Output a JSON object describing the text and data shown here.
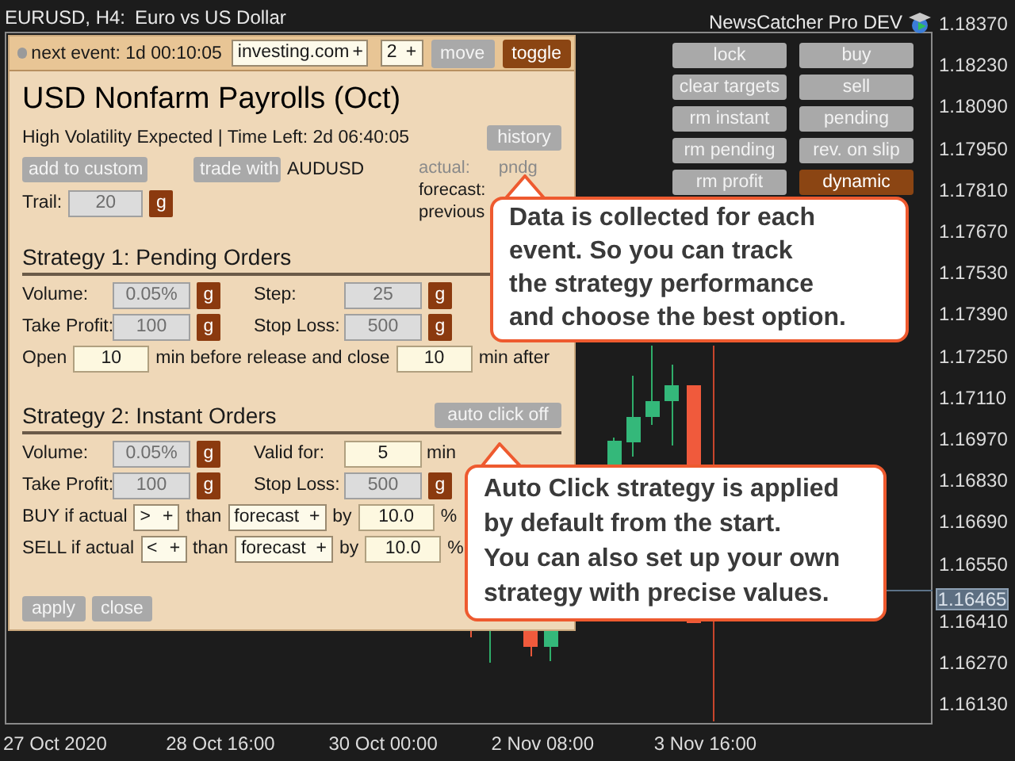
{
  "chart_header": {
    "symbol": "EURUSD, H4:",
    "description": "Euro vs US Dollar"
  },
  "expert_label": "NewsCatcher Pro DEV",
  "control_buttons": [
    {
      "label": "lock",
      "active": false
    },
    {
      "label": "buy",
      "active": false
    },
    {
      "label": "clear targets",
      "active": false
    },
    {
      "label": "sell",
      "active": false
    },
    {
      "label": "rm instant",
      "active": false
    },
    {
      "label": "pending",
      "active": false
    },
    {
      "label": "rm pending",
      "active": false
    },
    {
      "label": "rev. on slip",
      "active": false
    },
    {
      "label": "rm profit",
      "active": false
    },
    {
      "label": "dynamic",
      "active": true
    }
  ],
  "price_axis": [
    {
      "label": "1.18370",
      "current": false
    },
    {
      "label": "1.18230",
      "current": false
    },
    {
      "label": "1.18090",
      "current": false
    },
    {
      "label": "1.17950",
      "current": false
    },
    {
      "label": "1.17810",
      "current": false
    },
    {
      "label": "1.17670",
      "current": false
    },
    {
      "label": "1.17530",
      "current": false
    },
    {
      "label": "1.17390",
      "current": false
    },
    {
      "label": "1.17250",
      "current": false
    },
    {
      "label": "1.17110",
      "current": false
    },
    {
      "label": "1.16970",
      "current": false
    },
    {
      "label": "1.16830",
      "current": false
    },
    {
      "label": "1.16690",
      "current": false
    },
    {
      "label": "1.16550",
      "current": false
    },
    {
      "label": "1.16465",
      "current": true
    },
    {
      "label": "1.16410",
      "current": false
    },
    {
      "label": "1.16270",
      "current": false
    },
    {
      "label": "1.16130",
      "current": false
    }
  ],
  "time_axis": [
    "27 Oct 2020",
    "28 Oct 16:00",
    "30 Oct 00:00",
    "2 Nov 08:00",
    "3 Nov 16:00"
  ],
  "panel": {
    "next_event": "next event: 1d 00:10:05",
    "selects": [
      {
        "value": "investing.com",
        "toggle": "+"
      },
      {
        "value": "2",
        "toggle": "+"
      }
    ],
    "header_buttons": [
      {
        "label": "move",
        "active": false
      },
      {
        "label": "toggle",
        "active": true
      }
    ],
    "title": "USD Nonfarm Payrolls (Oct)",
    "subtitle": "High Volatility Expected | Time Left: 2d 06:40:05",
    "history_button": "history",
    "add_button": "add to custom",
    "trade_button": "trade with",
    "pair": "AUDUSD",
    "values": [
      {
        "label": "actual:",
        "value": "pndg",
        "muted": true
      },
      {
        "label": "forecast:",
        "muted": false
      },
      {
        "label": "previous",
        "muted": false
      }
    ],
    "trail": {
      "label": "Trail:",
      "value": "20",
      "disabled": true,
      "button": "g"
    },
    "strategies": [
      {
        "title": "Strategy 1: Pending Orders",
        "rows": [
          {
            "kind": "pair",
            "fields": [
              {
                "label": "Volume:",
                "value": "0.05%",
                "disabled": true,
                "button": "g"
              },
              {
                "label": "Step:",
                "value": "25",
                "disabled": true,
                "button": "g"
              }
            ]
          },
          {
            "kind": "pair",
            "fields": [
              {
                "label": "Take Profit:",
                "value": "100",
                "disabled": true,
                "button": "g"
              },
              {
                "label": "Stop Loss:",
                "value": "500",
                "disabled": true,
                "button": "g"
              }
            ]
          },
          {
            "kind": "line",
            "parts": [
              {
                "kind": "text",
                "text": "Open"
              },
              {
                "kind": "field",
                "value": "10"
              },
              {
                "kind": "text",
                "text": "min before release and close"
              },
              {
                "kind": "field",
                "value": "10"
              },
              {
                "kind": "text",
                "text": "min after"
              }
            ]
          }
        ]
      },
      {
        "title": "Strategy 2: Instant Orders",
        "button": "auto click off",
        "rows": [
          {
            "kind": "pair",
            "fields": [
              {
                "label": "Volume:",
                "value": "0.05%",
                "disabled": true,
                "button": "g"
              },
              {
                "label": "Valid for:",
                "value": "5",
                "disabled": false,
                "unit": "min"
              }
            ]
          },
          {
            "kind": "pair",
            "fields": [
              {
                "label": "Take Profit:",
                "value": "100",
                "disabled": true,
                "button": "g"
              },
              {
                "label": "Stop Loss:",
                "value": "500",
                "disabled": true,
                "button": "g"
              }
            ]
          },
          {
            "kind": "line",
            "parts": [
              {
                "kind": "text",
                "text": "BUY if actual"
              },
              {
                "kind": "select",
                "value": ">",
                "toggle": "+"
              },
              {
                "kind": "text",
                "text": "than"
              },
              {
                "kind": "select",
                "value": "forecast",
                "toggle": "+"
              },
              {
                "kind": "text",
                "text": "by"
              },
              {
                "kind": "field",
                "value": "10.0"
              },
              {
                "kind": "text",
                "text": "%"
              }
            ]
          },
          {
            "kind": "line",
            "parts": [
              {
                "kind": "text",
                "text": "SELL if actual"
              },
              {
                "kind": "select",
                "value": "<",
                "toggle": "+"
              },
              {
                "kind": "text",
                "text": "than"
              },
              {
                "kind": "select",
                "value": "forecast",
                "toggle": "+"
              },
              {
                "kind": "text",
                "text": "by"
              },
              {
                "kind": "field",
                "value": "10.0"
              },
              {
                "kind": "text",
                "text": "%"
              }
            ]
          }
        ]
      }
    ],
    "footer_buttons": [
      "apply",
      "close"
    ]
  },
  "callouts": [
    {
      "lines": [
        "Data is collected for each",
        "event. So you can track",
        "the strategy performance",
        "and choose the best option."
      ]
    },
    {
      "lines": [
        "Auto Click strategy is applied",
        "by default from the start.",
        "You can also set up your own",
        "strategy with precise values."
      ]
    }
  ]
}
